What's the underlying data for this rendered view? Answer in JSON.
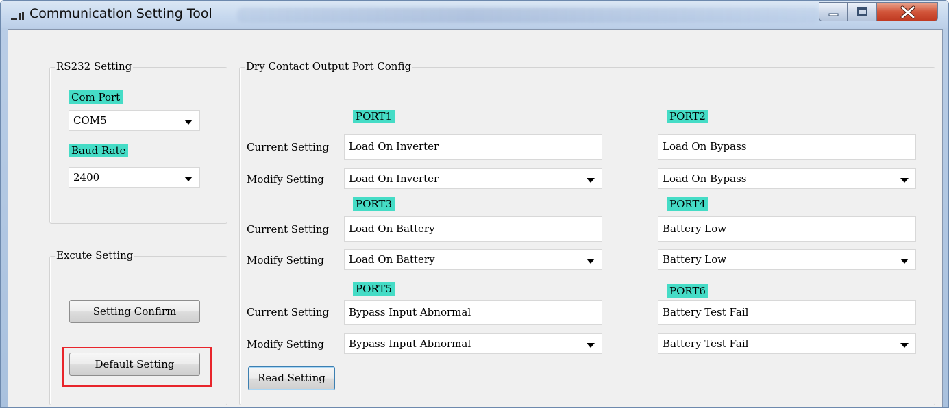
{
  "window": {
    "title": "Communication Setting Tool",
    "icons": {
      "app": "app-icon",
      "minimize": "minimize-icon",
      "maximize": "maximize-icon",
      "close": "close-icon"
    }
  },
  "rs232": {
    "legend": "RS232 Setting",
    "com_port_label": "Com Port",
    "com_port_value": "COM5",
    "baud_rate_label": "Baud Rate",
    "baud_rate_value": "2400"
  },
  "execute": {
    "legend": "Excute Setting",
    "confirm_label": "Setting Confirm",
    "default_label": "Default Setting"
  },
  "dry_contact": {
    "legend": "Dry Contact Output Port Config",
    "current_label": "Current Setting",
    "modify_label": "Modify Setting",
    "read_label": "Read Setting",
    "ports": [
      {
        "name": "PORT1",
        "current": "Load On Inverter",
        "modify": "Load On Inverter"
      },
      {
        "name": "PORT2",
        "current": "Load On Bypass",
        "modify": "Load On Bypass"
      },
      {
        "name": "PORT3",
        "current": "Load On Battery",
        "modify": "Load On Battery"
      },
      {
        "name": "PORT4",
        "current": "Battery Low",
        "modify": "Battery Low"
      },
      {
        "name": "PORT5",
        "current": "Bypass Input Abnormal",
        "modify": "Bypass Input Abnormal"
      },
      {
        "name": "PORT6",
        "current": "Battery Test Fail",
        "modify": "Battery Test Fail"
      }
    ]
  },
  "colors": {
    "port_highlight": "#45dcc6",
    "annotation_box": "#e8252b",
    "close_button": "#c03a22"
  }
}
